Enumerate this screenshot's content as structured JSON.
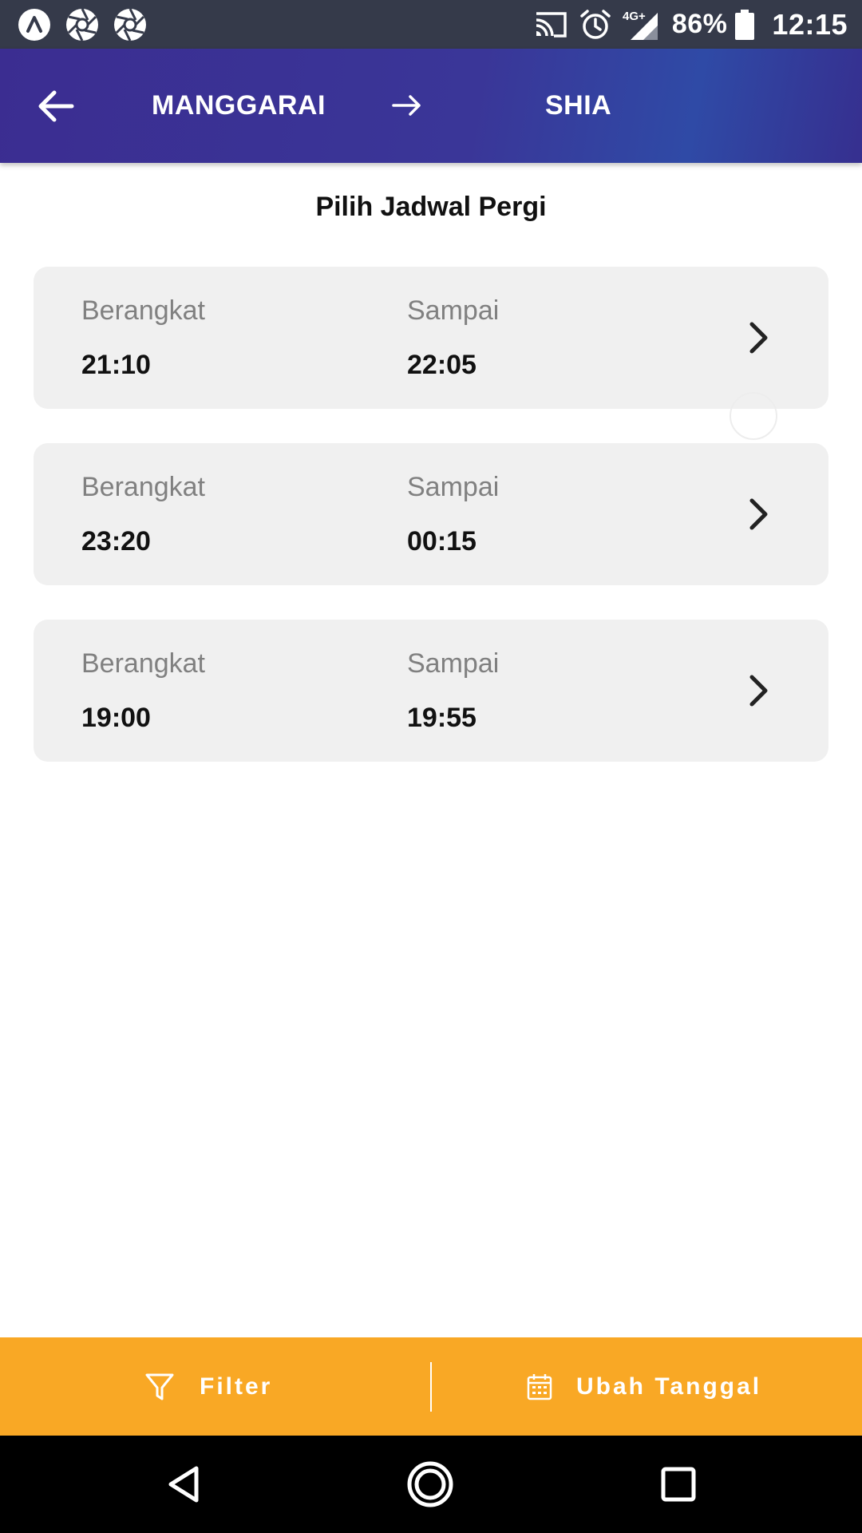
{
  "status_bar": {
    "notification_icons": [
      "app-a-icon",
      "shutter-icon",
      "shutter-icon"
    ],
    "system_icons": [
      "cast-icon",
      "alarm-icon",
      "signal-4g-icon"
    ],
    "network_label": "4G+",
    "battery_percent": "86%",
    "clock": "12:15"
  },
  "header": {
    "origin": "MANGGARAI",
    "destination": "SHIA",
    "background_color": "#3a3698"
  },
  "page_title": "Pilih Jadwal Pergi",
  "schedules": [
    {
      "depart_label": "Berangkat",
      "depart_time": "21:10",
      "arrive_label": "Sampai",
      "arrive_time": "22:05"
    },
    {
      "depart_label": "Berangkat",
      "depart_time": "23:20",
      "arrive_label": "Sampai",
      "arrive_time": "00:15"
    },
    {
      "depart_label": "Berangkat",
      "depart_time": "19:00",
      "arrive_label": "Sampai",
      "arrive_time": "19:55"
    }
  ],
  "action_bar": {
    "filter_label": "Filter",
    "change_date_label": "Ubah Tanggal",
    "background_color": "#f9a825"
  },
  "nav_bar": {
    "buttons": [
      "back-triangle-icon",
      "home-circle-icon",
      "recents-square-icon"
    ]
  }
}
